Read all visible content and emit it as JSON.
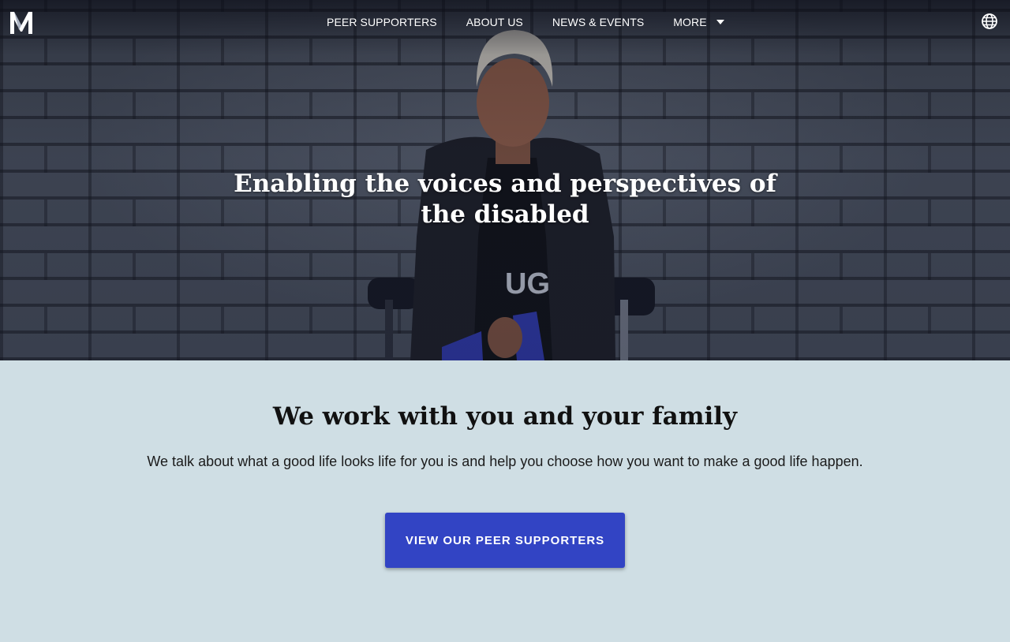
{
  "nav": {
    "logo": "M",
    "items": [
      {
        "label": "PEER SUPPORTERS"
      },
      {
        "label": "ABOUT US"
      },
      {
        "label": "NEWS & EVENTS"
      },
      {
        "label": "MORE"
      }
    ],
    "language_icon": "globe-icon",
    "more_icon": "caret-down-icon"
  },
  "hero": {
    "title": "Enabling the voices and perspectives of the disabled"
  },
  "section": {
    "heading": "We work with you and your family",
    "text": "We talk about what a good life looks life for you is and help you choose how you want to make a good life happen.",
    "button_label": "VIEW OUR PEER SUPPORTERS"
  },
  "colors": {
    "accent": "#3244c4",
    "section_background": "#cfdee4",
    "nav_text": "#ffffff"
  }
}
